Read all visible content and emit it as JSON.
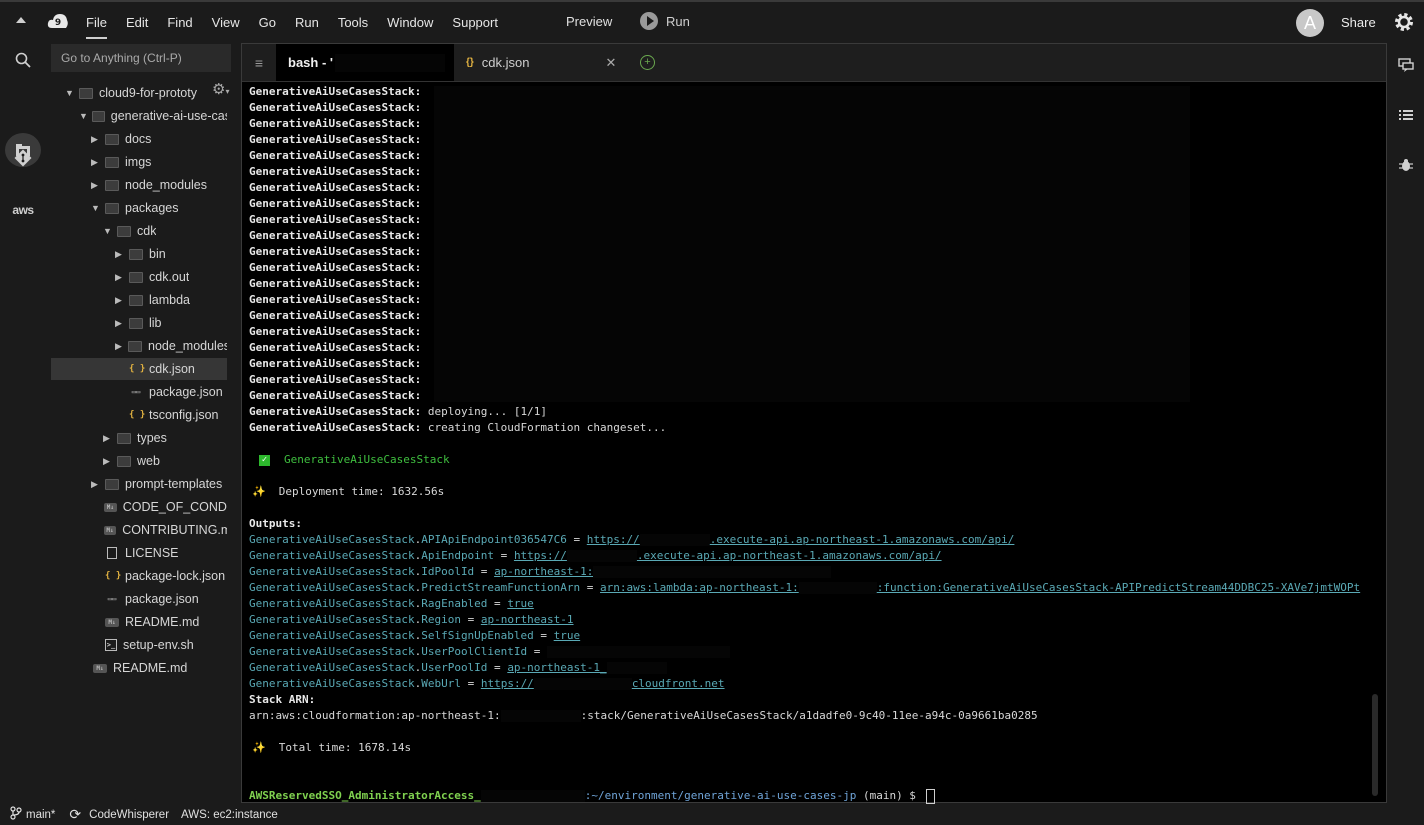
{
  "menu": [
    "File",
    "Edit",
    "Find",
    "View",
    "Go",
    "Run",
    "Tools",
    "Window",
    "Support"
  ],
  "header": {
    "preview": "Preview",
    "run": "Run",
    "avatar_letter": "A",
    "share": "Share"
  },
  "sidebar": {
    "goto_placeholder": "Go to Anything (Ctrl-P)",
    "tree": [
      {
        "label": "cloud9-for-prototy",
        "type": "folder",
        "expanded": true
      },
      {
        "label": "generative-ai-use-case",
        "type": "folder",
        "expanded": true
      },
      {
        "label": "docs",
        "type": "folder",
        "expanded": false
      },
      {
        "label": "imgs",
        "type": "folder",
        "expanded": false
      },
      {
        "label": "node_modules",
        "type": "folder",
        "expanded": false
      },
      {
        "label": "packages",
        "type": "folder",
        "expanded": true
      },
      {
        "label": "cdk",
        "type": "folder",
        "expanded": true
      },
      {
        "label": "bin",
        "type": "folder",
        "expanded": false
      },
      {
        "label": "cdk.out",
        "type": "folder",
        "expanded": false
      },
      {
        "label": "lambda",
        "type": "folder",
        "expanded": false
      },
      {
        "label": "lib",
        "type": "folder",
        "expanded": false
      },
      {
        "label": "node_modules",
        "type": "folder",
        "expanded": false
      },
      {
        "label": "cdk.json",
        "type": "json",
        "selected": true
      },
      {
        "label": "package.json",
        "type": "pkg"
      },
      {
        "label": "tsconfig.json",
        "type": "json"
      },
      {
        "label": "types",
        "type": "folder",
        "expanded": false
      },
      {
        "label": "web",
        "type": "folder",
        "expanded": false
      },
      {
        "label": "prompt-templates",
        "type": "folder",
        "expanded": false
      },
      {
        "label": "CODE_OF_CONDU",
        "type": "md"
      },
      {
        "label": "CONTRIBUTING.md",
        "type": "md"
      },
      {
        "label": "LICENSE",
        "type": "doc"
      },
      {
        "label": "package-lock.json",
        "type": "json"
      },
      {
        "label": "package.json",
        "type": "pkg"
      },
      {
        "label": "README.md",
        "type": "md"
      },
      {
        "label": "setup-env.sh",
        "type": "sh"
      },
      {
        "label": "README.md",
        "type": "md"
      }
    ]
  },
  "tabs": [
    {
      "label": "bash - '",
      "active": true
    },
    {
      "label": "cdk.json",
      "icon": "{}",
      "active": false
    }
  ],
  "terminal": {
    "stack": "GenerativeAiUseCasesStack",
    "colon": ":",
    "deploying": " deploying... [1/1]",
    "creating": " creating CloudFormation changeset...",
    "success_stack": "GenerativeAiUseCasesStack",
    "deployment_time": "Deployment time: 1632.56s",
    "outputs_label": "Outputs:",
    "outputs": [
      {
        "key": "APIApiEndpoint036547C6",
        "pre": "https://",
        "post": ".execute-api.ap-northeast-1.amazonaws.com/api/"
      },
      {
        "key": "ApiEndpoint",
        "pre": "https://",
        "post": ".execute-api.ap-northeast-1.amazonaws.com/api/"
      },
      {
        "key": "IdPoolId",
        "pre": "ap-northeast-1:",
        "post": ""
      },
      {
        "key": "PredictStreamFunctionArn",
        "pre": "arn:aws:lambda:ap-northeast-1:",
        "post": ":function:GenerativeAiUseCasesStack-APIPredictStream44DDBC25-XAVe7jmtWOPt"
      },
      {
        "key": "RagEnabled",
        "pre": "true",
        "post": ""
      },
      {
        "key": "Region",
        "pre": "ap-northeast-1",
        "post": ""
      },
      {
        "key": "SelfSignUpEnabled",
        "pre": "true",
        "post": ""
      },
      {
        "key": "UserPoolClientId",
        "pre": "",
        "post": ""
      },
      {
        "key": "UserPoolId",
        "pre": "ap-northeast-1_",
        "post": ""
      },
      {
        "key": "WebUrl",
        "pre": "https://",
        "post": "cloudfront.net"
      }
    ],
    "eq": " = ",
    "stack_arn_label": "Stack ARN:",
    "arn_pre": "arn:aws:cloudformation:ap-northeast-1:",
    "arn_post": ":stack/GenerativeAiUseCasesStack/a1dadfe0-9c40-11ee-a94c-0a9661ba0285",
    "total_time": "Total time: 1678.14s",
    "prompt_user": "AWSReservedSSO_AdministratorAccess_",
    "prompt_path": ":~/environment/generative-ai-use-cases-jp",
    "prompt_branch": " (main) $ "
  },
  "status": {
    "branch": "main*",
    "codewhisperer": "CodeWhisperer",
    "aws": "AWS: ec2:instance"
  }
}
